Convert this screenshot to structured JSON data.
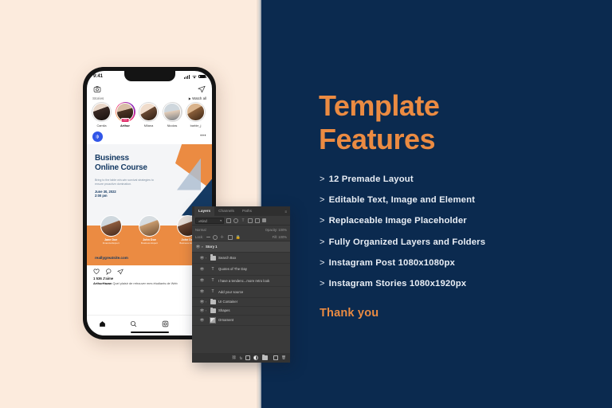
{
  "colors": {
    "cream": "#FCEBDD",
    "navy": "#0B2A4F",
    "orange": "#EB8B42",
    "light_text": "#E9EEF5"
  },
  "right_panel": {
    "title_line1": "Template",
    "title_line2": "Features",
    "features": [
      {
        "caret": ">",
        "label": "12 Premade Layout"
      },
      {
        "caret": ">",
        "label": "Editable Text, Image and Element"
      },
      {
        "caret": ">",
        "label": "Replaceable Image Placeholder"
      },
      {
        "caret": ">",
        "label": "Fully Organized Layers and Folders"
      },
      {
        "caret": ">",
        "label": "Instagram Post 1080x1080px"
      },
      {
        "caret": ">",
        "label": "Instagram Stories 1080x1920px"
      }
    ],
    "thank_you": "Thank you"
  },
  "phone": {
    "status": {
      "time": "9:41",
      "signal_icon": "cellular-signal-icon",
      "wifi_icon": "wifi-icon",
      "battery_icon": "battery-icon"
    },
    "topbar": {
      "left_icon": "camera-icon",
      "right_icon": "direct-message-icon"
    },
    "stories": {
      "label": "Stories",
      "watch_all": "Watch all",
      "items": [
        {
          "name": "Camila",
          "active": false,
          "badge": ""
        },
        {
          "name": "Arthur",
          "active": true,
          "badge": "new"
        },
        {
          "name": "Milana",
          "active": false,
          "badge": ""
        },
        {
          "name": "Nicolas",
          "active": false,
          "badge": ""
        },
        {
          "name": "barbie_j",
          "active": false,
          "badge": ""
        }
      ]
    },
    "post": {
      "avatar_icon": "brand-logo-icon",
      "menu_icon": "more-options-icon",
      "art": {
        "title_line1": "Business",
        "title_line2": "Online Course",
        "subtitle": "Bring to the table win-win survival strategies to ensure proactive domination.",
        "date": "June 30, 2022",
        "time": "2:00 pm",
        "speakers": [
          {
            "name": "Jane Doe",
            "role": "Financial Expert"
          },
          {
            "name": "John Doe",
            "role": "Business Expert"
          },
          {
            "name": "John Doe",
            "role": "Business Expert"
          }
        ],
        "website": "reallygreatsite.com"
      },
      "actions": {
        "like_icon": "heart-icon",
        "comment_icon": "comment-icon",
        "share_icon": "share-icon"
      },
      "likes": "1 536 J'aime",
      "caption_user": "ArthurHazan",
      "caption_text": "Quel plaisir de retrouver mes étudiants de Web"
    },
    "tabbar": [
      {
        "icon": "home-icon"
      },
      {
        "icon": "search-icon"
      },
      {
        "icon": "reels-icon"
      },
      {
        "icon": "bookmark-icon"
      }
    ]
  },
  "photoshop": {
    "tabs": [
      {
        "label": "Layers",
        "active": true
      },
      {
        "label": "Channels",
        "active": false
      },
      {
        "label": "Paths",
        "active": false
      }
    ],
    "panel_menu_icon": "panel-menu-icon",
    "filter": {
      "kind_label": "Kind",
      "search_icon": "search-icon",
      "icons": [
        "pixel-filter-icon",
        "adjustment-filter-icon",
        "type-filter-icon",
        "shape-filter-icon",
        "smart-object-filter-icon",
        "filter-toggle-icon"
      ]
    },
    "blend_mode": "Normal",
    "opacity_label": "Opacity:",
    "opacity_value": "100%",
    "lock_label": "Lock:",
    "fill_label": "Fill:",
    "fill_value": "100%",
    "lock_icons": [
      "lock-transparent-pixels-icon",
      "lock-image-pixels-icon",
      "lock-position-icon",
      "lock-artboard-icon",
      "lock-all-icon"
    ],
    "layers": [
      {
        "name": "Story 1",
        "type": "group-head",
        "expanded": true,
        "eye": true
      },
      {
        "name": "Search Box",
        "type": "folder",
        "eye": true
      },
      {
        "name": "Quotes of The Day",
        "type": "text",
        "eye": true
      },
      {
        "name": "I have a tendenc...more retro look",
        "type": "text",
        "eye": true
      },
      {
        "name": "Add your source",
        "type": "text",
        "eye": true
      },
      {
        "name": "UI Container",
        "type": "folder",
        "eye": true
      },
      {
        "name": "Shapes",
        "type": "folder",
        "eye": true
      },
      {
        "name": "Ornament",
        "type": "image",
        "eye": true
      }
    ],
    "bottom_icons": [
      "link-layers-icon",
      "layer-style-fx-icon",
      "layer-mask-icon",
      "adjustment-layer-icon",
      "new-group-icon",
      "new-layer-icon",
      "delete-layer-icon"
    ]
  }
}
